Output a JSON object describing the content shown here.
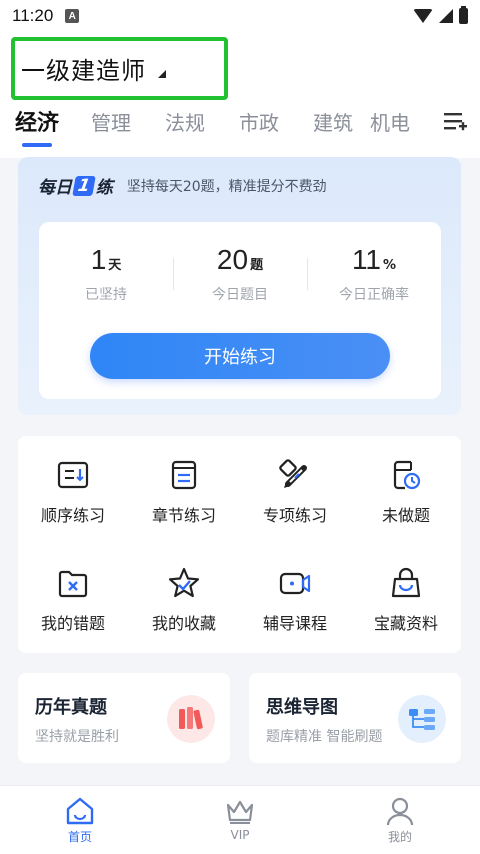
{
  "status_bar": {
    "time": "11:20",
    "a_badge": "A"
  },
  "header": {
    "exam_title": "一级建造师",
    "tabs": [
      {
        "label": "经济",
        "active": true
      },
      {
        "label": "管理"
      },
      {
        "label": "法规"
      },
      {
        "label": "市政"
      },
      {
        "label": "建筑"
      },
      {
        "label": "机电"
      }
    ]
  },
  "daily": {
    "logo_left": "每日",
    "logo_num": "1",
    "logo_right": "练",
    "tagline": "坚持每天20题，精准提分不费劲",
    "stats": [
      {
        "value": "1",
        "unit": "天",
        "label": "已坚持"
      },
      {
        "value": "20",
        "unit": "题",
        "label": "今日题目"
      },
      {
        "value": "11",
        "unit": "%",
        "label": "今日正确率"
      }
    ],
    "start_button": "开始练习"
  },
  "grid": [
    {
      "label": "顺序练习",
      "icon": "list-order-icon"
    },
    {
      "label": "章节练习",
      "icon": "chapter-icon"
    },
    {
      "label": "专项练习",
      "icon": "special-pencil-icon"
    },
    {
      "label": "未做题",
      "icon": "clock-doc-icon"
    },
    {
      "label": "我的错题",
      "icon": "wrong-folder-icon"
    },
    {
      "label": "我的收藏",
      "icon": "star-icon"
    },
    {
      "label": "辅导课程",
      "icon": "video-icon"
    },
    {
      "label": "宝藏资料",
      "icon": "bag-icon"
    }
  ],
  "cards": [
    {
      "title": "历年真题",
      "sub": "坚持就是胜利",
      "icon": "books-icon",
      "accent": "#f25a5a"
    },
    {
      "title": "思维导图",
      "sub": "题库精准 智能刷题",
      "icon": "mindmap-icon",
      "accent": "#3a8df5"
    }
  ],
  "bottom_nav": [
    {
      "label": "首页",
      "icon": "home-icon",
      "active": true
    },
    {
      "label": "VIP",
      "icon": "crown-icon"
    },
    {
      "label": "我的",
      "icon": "person-icon"
    }
  ],
  "colors": {
    "accent": "#2f6bf5",
    "highlight_box": "#22c131"
  }
}
